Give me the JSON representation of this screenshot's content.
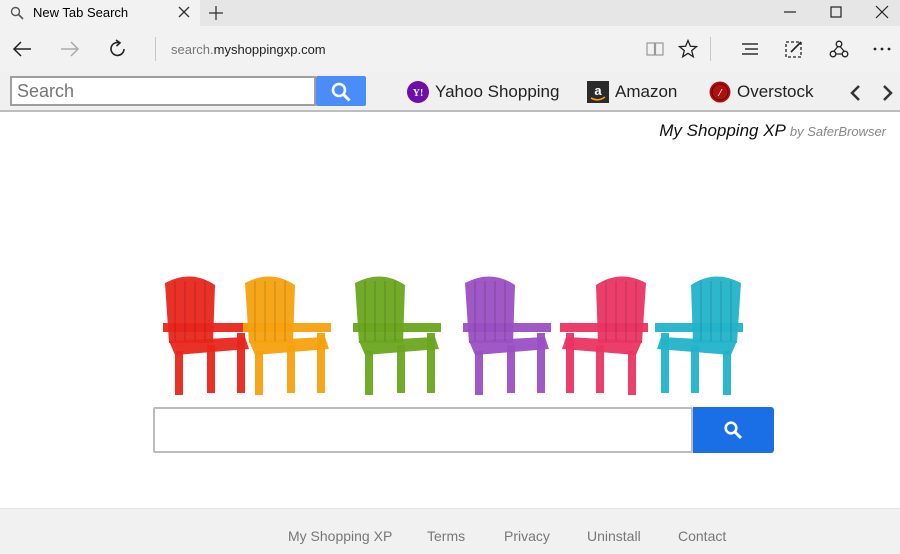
{
  "browser": {
    "tab": {
      "title": "New Tab Search"
    },
    "address": {
      "url_prefix": "search.",
      "url_domain": "myshoppingxp.com"
    }
  },
  "searchbar": {
    "placeholder": "Search",
    "bookmarks": [
      {
        "label": "Yahoo Shopping",
        "icon": "yahoo-icon",
        "color": "#6b0fa8"
      },
      {
        "label": "Amazon",
        "icon": "amazon-icon",
        "color": "#2b2b2b"
      },
      {
        "label": "Overstock",
        "icon": "overstock-icon",
        "color": "#b01010"
      }
    ]
  },
  "page": {
    "brand_name": "My Shopping XP",
    "brand_by": "by SaferBrowser",
    "search_placeholder": "",
    "chair_colors": [
      "#e8261c",
      "#f5a10f",
      "#6aa51e",
      "#9a4fc2",
      "#ea3463",
      "#22b3c9"
    ]
  },
  "footer": {
    "links": [
      "My Shopping XP",
      "Terms",
      "Privacy",
      "Uninstall",
      "Contact"
    ]
  },
  "colors": {
    "accent": "#1a6ee6",
    "searchbar_button": "#4b8df8"
  }
}
